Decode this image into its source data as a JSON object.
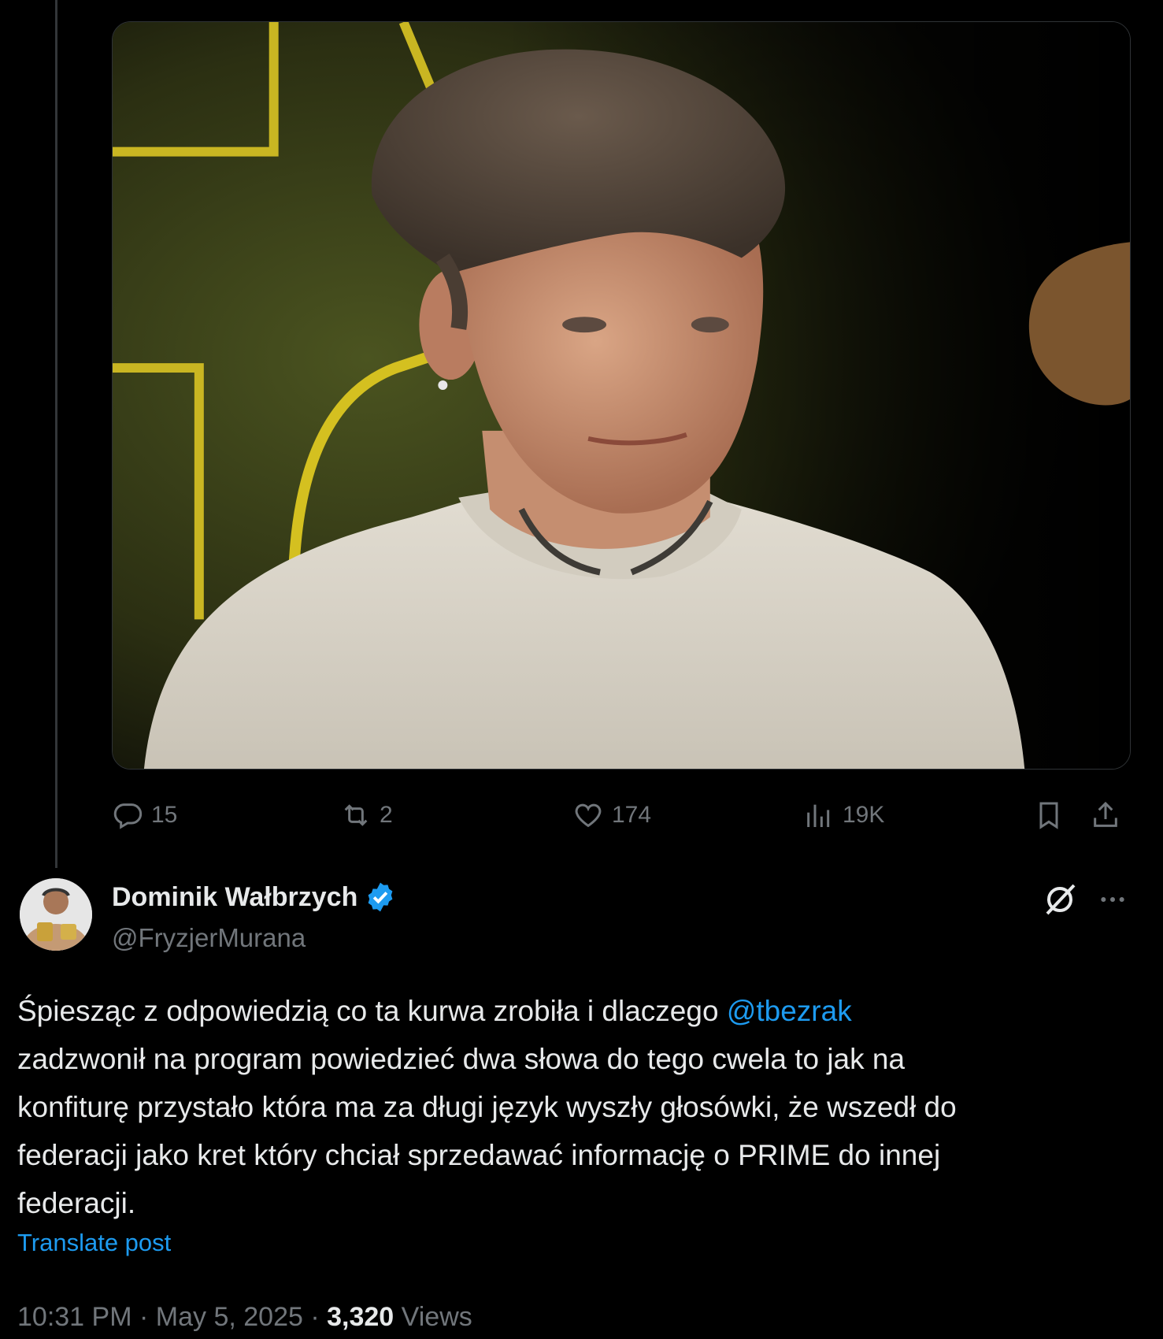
{
  "media": {
    "description_icon": "photo"
  },
  "actions": {
    "replies": "15",
    "reposts": "2",
    "likes": "174",
    "views": "19K"
  },
  "tweet": {
    "display_name": "Dominik Wałbrzych",
    "handle": "@FryzjerMurana",
    "text_before_mention": "Śpiesząc z odpowiedzią co ta kurwa zrobiła i dlaczego ",
    "mention": "@tbezrak",
    "text_after_mention": "\nzadzwonił na program powiedzieć dwa słowa do tego cwela to jak na\nkonfiturę przystało która ma za długi język wyszły głosówki, że wszedł do\nfederacji jako kret który chciał sprzedawać informację o PRIME do innej\nfederacji.",
    "translate_label": "Translate post",
    "time": "10:31 PM",
    "date": "May 5, 2025",
    "separator": "·",
    "views_count": "3,320",
    "views_label": "Views"
  },
  "colors": {
    "background": "#000000",
    "text": "#e7e9ea",
    "muted": "#71767b",
    "accent": "#1d9bf0",
    "verified": "#1d9bf0"
  }
}
